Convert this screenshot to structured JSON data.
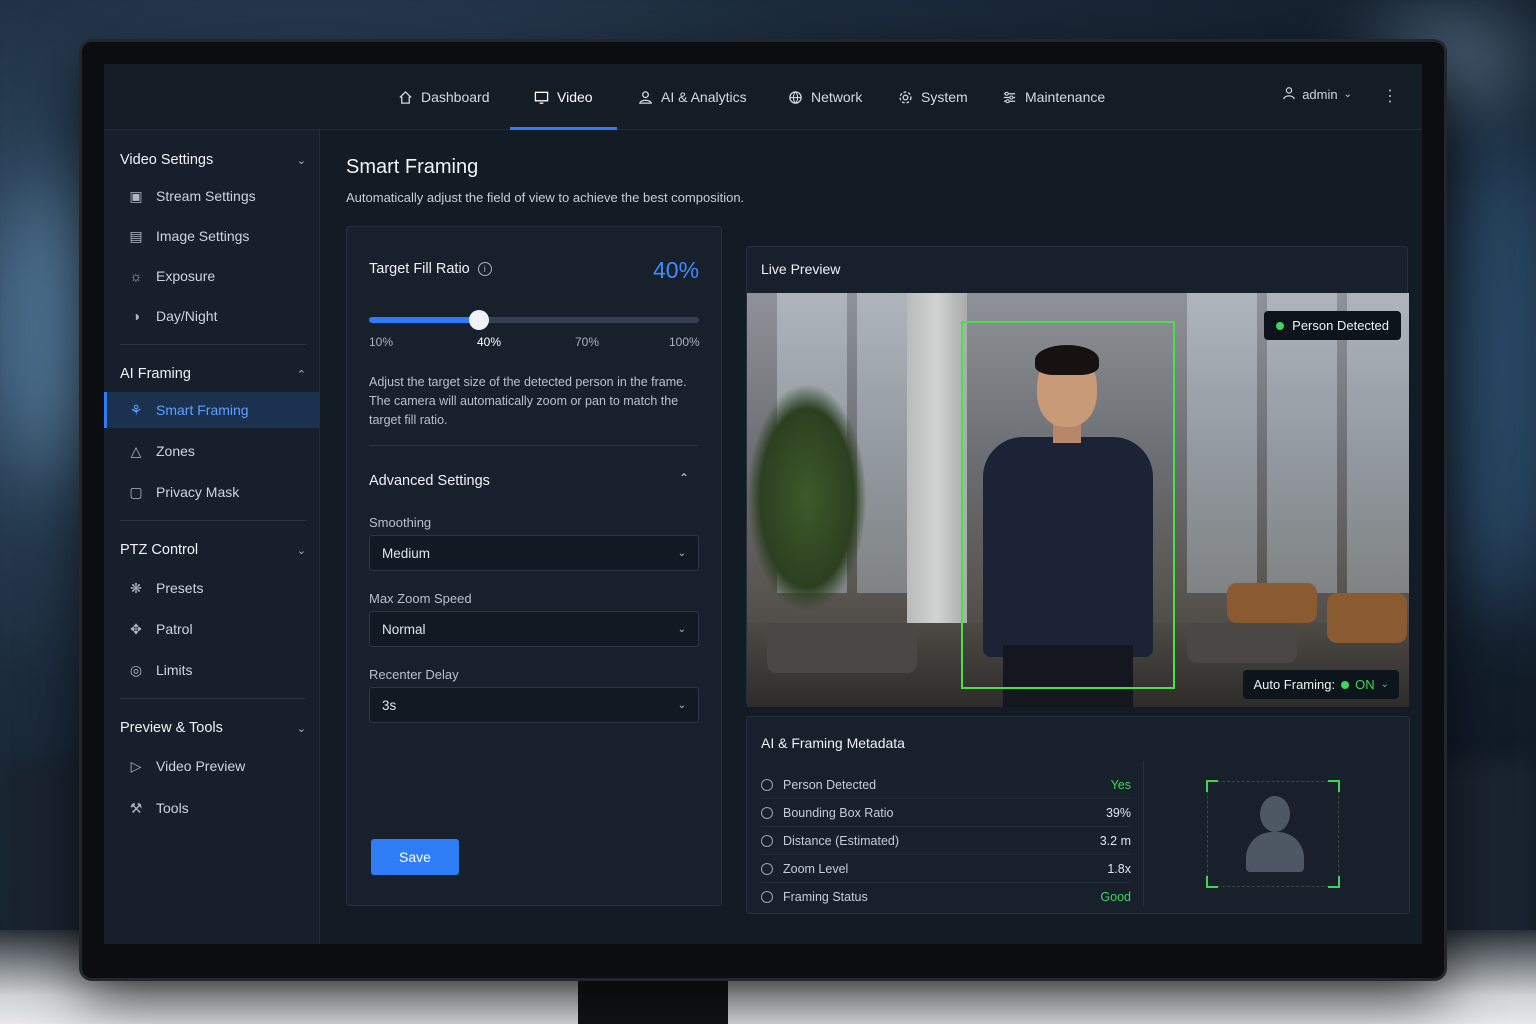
{
  "nav": {
    "tabs": [
      {
        "label": "Dashboard",
        "icon": "home-icon"
      },
      {
        "label": "Video",
        "icon": "monitor-icon"
      },
      {
        "label": "AI & Analytics",
        "icon": "ai-icon"
      },
      {
        "label": "Network",
        "icon": "globe-icon"
      },
      {
        "label": "System",
        "icon": "gear-icon"
      },
      {
        "label": "Maintenance",
        "icon": "sliders-icon"
      }
    ],
    "active_tab": "Video",
    "user": "admin"
  },
  "sidebar": {
    "sections": [
      {
        "title": "Video Settings",
        "items": [
          "Stream Settings",
          "Image Settings",
          "Exposure",
          "Day/Night"
        ]
      },
      {
        "title": "AI Framing",
        "items": [
          "Smart Framing",
          "Zones",
          "Privacy Mask"
        ]
      },
      {
        "title": "PTZ Control",
        "items": [
          "Presets",
          "Patrol",
          "Limits"
        ]
      },
      {
        "title": "Preview & Tools",
        "items": [
          "Video Preview",
          "Tools"
        ]
      }
    ],
    "active_item": "Smart Framing"
  },
  "page": {
    "title": "Smart Framing",
    "subtitle": "Automatically adjust the field of view to achieve the best composition."
  },
  "fill_ratio": {
    "label": "Target Fill Ratio",
    "value_text": "40%",
    "value": 40,
    "ticks": [
      "10%",
      "40%",
      "70%",
      "100%"
    ],
    "description": "Adjust the target size of the detected person in the frame. The camera will automatically zoom or pan to match the target fill ratio."
  },
  "advanced": {
    "title": "Advanced Settings",
    "smoothing": {
      "label": "Smoothing",
      "value": "Medium"
    },
    "max_zoom": {
      "label": "Max Zoom Speed",
      "value": "Normal"
    },
    "recenter": {
      "label": "Recenter Delay",
      "value": "3s"
    },
    "save": "Save"
  },
  "preview": {
    "title": "Live Preview",
    "badge": "Person Detected",
    "auto_framing_label": "Auto Framing:",
    "auto_framing_value": "ON"
  },
  "metadata": {
    "title": "AI & Framing Metadata",
    "rows": [
      {
        "label": "Person Detected",
        "value": "Yes"
      },
      {
        "label": "Bounding Box Ratio",
        "value": "39%"
      },
      {
        "label": "Distance (Estimated)",
        "value": "3.2 m"
      },
      {
        "label": "Zoom Level",
        "value": "1.8x"
      },
      {
        "label": "Framing Status",
        "value": "Good"
      }
    ]
  },
  "colors": {
    "accent": "#2f7df6",
    "success": "#3ed65a",
    "bbox": "#4ae04a"
  }
}
